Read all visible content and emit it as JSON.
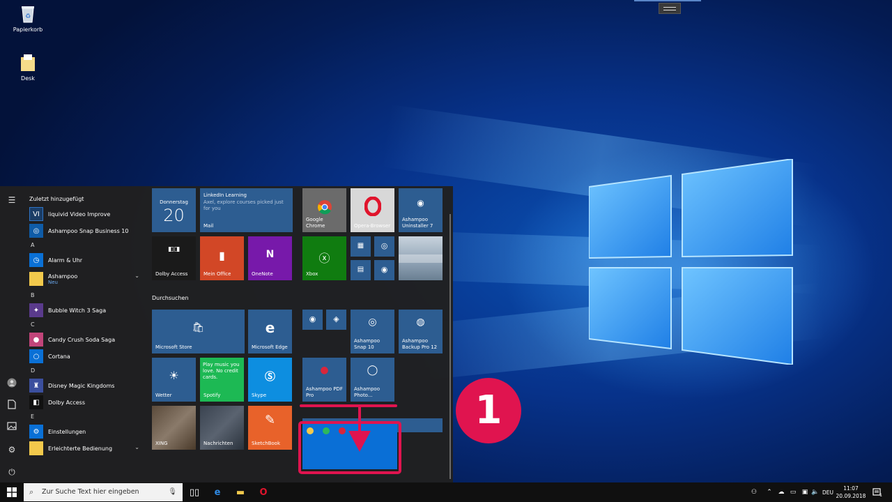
{
  "desktop": {
    "icons": [
      {
        "label": "Papierkorb"
      },
      {
        "label": "Desk"
      }
    ]
  },
  "start_menu": {
    "recent_header": "Zuletzt hinzugefügt",
    "recent": [
      {
        "label": "liquivid Video Improve"
      },
      {
        "label": "Ashampoo Snap Business 10"
      }
    ],
    "groups": [
      {
        "letter": "A",
        "items": [
          {
            "label": "Alarm & Uhr"
          },
          {
            "label": "Ashampoo",
            "sub": "Neu"
          }
        ]
      },
      {
        "letter": "B",
        "items": [
          {
            "label": "Bubble Witch 3 Saga"
          }
        ]
      },
      {
        "letter": "C",
        "items": [
          {
            "label": "Candy Crush Soda Saga"
          },
          {
            "label": "Cortana"
          }
        ]
      },
      {
        "letter": "D",
        "items": [
          {
            "label": "Disney Magic Kingdoms"
          },
          {
            "label": "Dolby Access"
          }
        ]
      },
      {
        "letter": "E",
        "items": [
          {
            "label": "Einstellungen"
          },
          {
            "label": "Erleichterte Bedienung"
          }
        ]
      }
    ],
    "section_browse": "Durchsuchen",
    "tiles": {
      "calendar_day": "Donnerstag",
      "calendar_date": "20",
      "mail_title": "LinkedIn Learning",
      "mail_body": "Axel, explore courses picked just for you",
      "mail_label": "Mail",
      "dolby": "Dolby Access",
      "office": "Mein Office",
      "onenote": "OneNote",
      "chrome": "Google Chrome",
      "opera": "Opera-Browser",
      "uninstaller": "Ashampoo Uninstaller 7",
      "xbox": "Xbox",
      "store": "Microsoft Store",
      "edge": "Microsoft Edge",
      "snap": "Ashampoo Snap 10",
      "backup": "Ashampoo Backup Pro 12",
      "weather": "Wetter",
      "spotify_text": "Play music you love. No credit cards.",
      "spotify": "Spotify",
      "skype": "Skype",
      "pdf": "Ashampoo PDF Pro",
      "photo": "Ashampoo Photo...",
      "xing": "XING",
      "news": "Nachrichten",
      "sketchbook": "SketchBook"
    }
  },
  "annotation": {
    "number": "1"
  },
  "taskbar": {
    "search_placeholder": "Zur Suche Text hier eingeben",
    "language": "DEU",
    "time": "11:07",
    "date": "20.09.2018",
    "notifications": "1"
  }
}
